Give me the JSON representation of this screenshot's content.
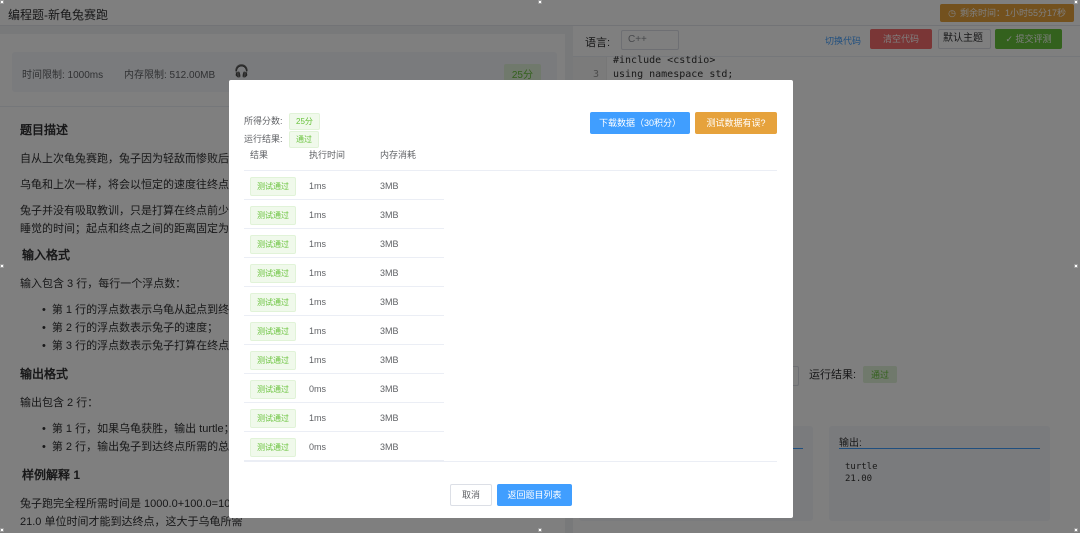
{
  "header": {
    "title": "编程题-新龟兔赛跑",
    "timer": "剩余时间：1小时55分17秒"
  },
  "limits": {
    "time": "时间限制: 1000ms",
    "memory": "内存限制: 512.00MB",
    "score": "25分"
  },
  "problem": {
    "desc_heading": "题目描述",
    "desc_p1": "自从上次龟兔赛跑，兔子因为轻敌而惨败后，",
    "desc_p2": "乌龟和上次一样，将会以恒定的速度往终点跑",
    "desc_p3": "兔子并没有吸取教训，只是打算在终点前少睡",
    "desc_p4": "睡觉的时间；起点和终点之间的距离固定为 1",
    "input_heading": "输入格式",
    "input_intro": "输入包含 3 行，每行一个浮点数：",
    "input_items": [
      "第 1 行的浮点数表示乌龟从起点到终点所",
      "第 2 行的浮点数表示兔子的速度；",
      "第 3 行的浮点数表示兔子打算在终点前睡"
    ],
    "output_heading": "输出格式",
    "output_intro": "输出包含 2 行：",
    "output_items": [
      "第 1 行，如果乌龟获胜，输出 turtle；如",
      "第 2 行，输出兔子到达终点所需的总时间"
    ],
    "example_heading": "样例解释 1",
    "example_p1": "兔子跑完全程所需时间是 1000.0+100.0=10.0",
    "example_p2": "21.0 单位时间才能到达终点，这大于乌龟所需"
  },
  "editor": {
    "lang_label": "语言:",
    "lang_value": "C++",
    "link_label": "切换代码",
    "reset_label": "清空代码",
    "theme_label": "默认主题",
    "submit_label": "✓ 提交评测",
    "code_line2": "#include <cstdio>",
    "line3_num": "3",
    "code_line3": "using namespace std;",
    "run_result_label": "运行结果:",
    "run_result_badge": "通过",
    "output_label": "输出:",
    "output_line1": "turtle",
    "output_line2": "21.00"
  },
  "modal": {
    "score_label": "所得分数:",
    "score_value": "25分",
    "result_label": "运行结果:",
    "result_value": "通过",
    "download_btn": "下载数据（30积分）",
    "report_btn": "测试数据有误?",
    "columns": [
      "结果",
      "执行时间",
      "内存消耗"
    ],
    "rows": [
      {
        "status": "测试通过",
        "time": "1ms",
        "mem": "3MB"
      },
      {
        "status": "测试通过",
        "time": "1ms",
        "mem": "3MB"
      },
      {
        "status": "测试通过",
        "time": "1ms",
        "mem": "3MB"
      },
      {
        "status": "测试通过",
        "time": "1ms",
        "mem": "3MB"
      },
      {
        "status": "测试通过",
        "time": "1ms",
        "mem": "3MB"
      },
      {
        "status": "测试通过",
        "time": "1ms",
        "mem": "3MB"
      },
      {
        "status": "测试通过",
        "time": "1ms",
        "mem": "3MB"
      },
      {
        "status": "测试通过",
        "time": "0ms",
        "mem": "3MB"
      },
      {
        "status": "测试通过",
        "time": "1ms",
        "mem": "3MB"
      },
      {
        "status": "测试通过",
        "time": "0ms",
        "mem": "3MB"
      }
    ],
    "cancel_btn": "取消",
    "return_btn": "返回题目列表"
  }
}
